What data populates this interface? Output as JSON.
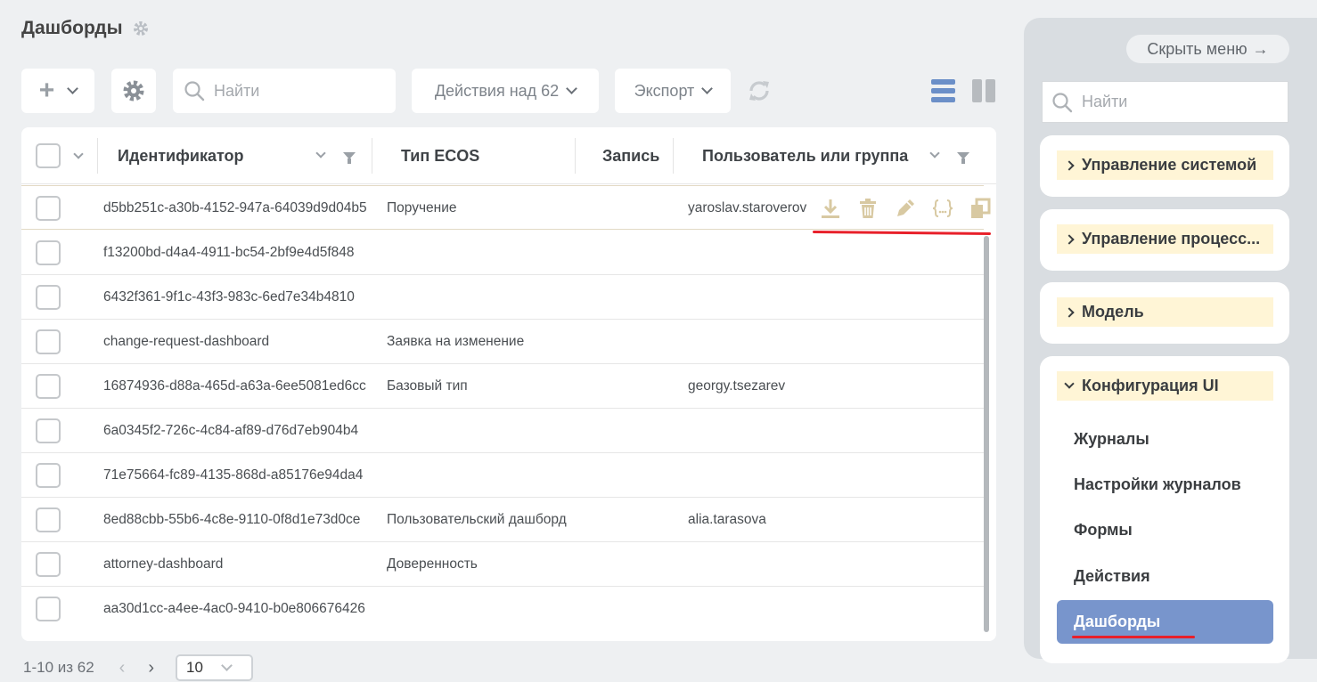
{
  "page": {
    "title": "Дашборды"
  },
  "toolbar": {
    "search_placeholder": "Найти",
    "actions_label": "Действия над 62",
    "export_label": "Экспорт"
  },
  "table": {
    "columns": [
      "Идентификатор",
      "Тип ECOS",
      "Запись",
      "Пользователь или группа"
    ],
    "rows": [
      {
        "id": "d5bb251c-a30b-4152-947a-64039d9d04b5",
        "type": "Поручение",
        "user": "yaroslav.staroverov"
      },
      {
        "id": "f13200bd-d4a4-4911-bc54-2bf9e4d5f848",
        "type": "",
        "user": ""
      },
      {
        "id": "6432f361-9f1c-43f3-983c-6ed7e34b4810",
        "type": "",
        "user": ""
      },
      {
        "id": "change-request-dashboard",
        "type": "Заявка на изменение",
        "user": ""
      },
      {
        "id": "16874936-d88a-465d-a63a-6ee5081ed6cc",
        "type": "Базовый тип",
        "user": "georgy.tsezarev"
      },
      {
        "id": "6a0345f2-726c-4c84-af89-d76d7eb904b4",
        "type": "",
        "user": ""
      },
      {
        "id": "71e75664-fc89-4135-868d-a85176e94da4",
        "type": "",
        "user": ""
      },
      {
        "id": "8ed88cbb-55b6-4c8e-9110-0f8d1e73d0ce",
        "type": "Пользовательский дашборд",
        "user": "alia.tarasova"
      },
      {
        "id": "attorney-dashboard",
        "type": "Доверенность",
        "user": ""
      },
      {
        "id": "aa30d1cc-a4ee-4ac0-9410-b0e806676426",
        "type": "",
        "user": ""
      }
    ],
    "row_action_icons": [
      "download-icon",
      "trash-icon",
      "pencil-icon",
      "braces-icon",
      "copy-icon"
    ]
  },
  "pager": {
    "range": "1-10 из 62",
    "page_size": "10"
  },
  "sidebar": {
    "hide_label": "Скрыть меню",
    "search_placeholder": "Найти",
    "sections": [
      {
        "label": "Управление системой",
        "expanded": false
      },
      {
        "label": "Управление процесс...",
        "expanded": false
      },
      {
        "label": "Модель",
        "expanded": false
      },
      {
        "label": "Конфигурация UI",
        "expanded": true
      }
    ],
    "ui_items": [
      "Журналы",
      "Настройки журналов",
      "Формы",
      "Действия",
      "Дашборды"
    ],
    "active_item": "Дашборды"
  },
  "colors": {
    "accent": "#7895cc",
    "highlight": "#fff5d6",
    "annotation": "#e8202a"
  }
}
